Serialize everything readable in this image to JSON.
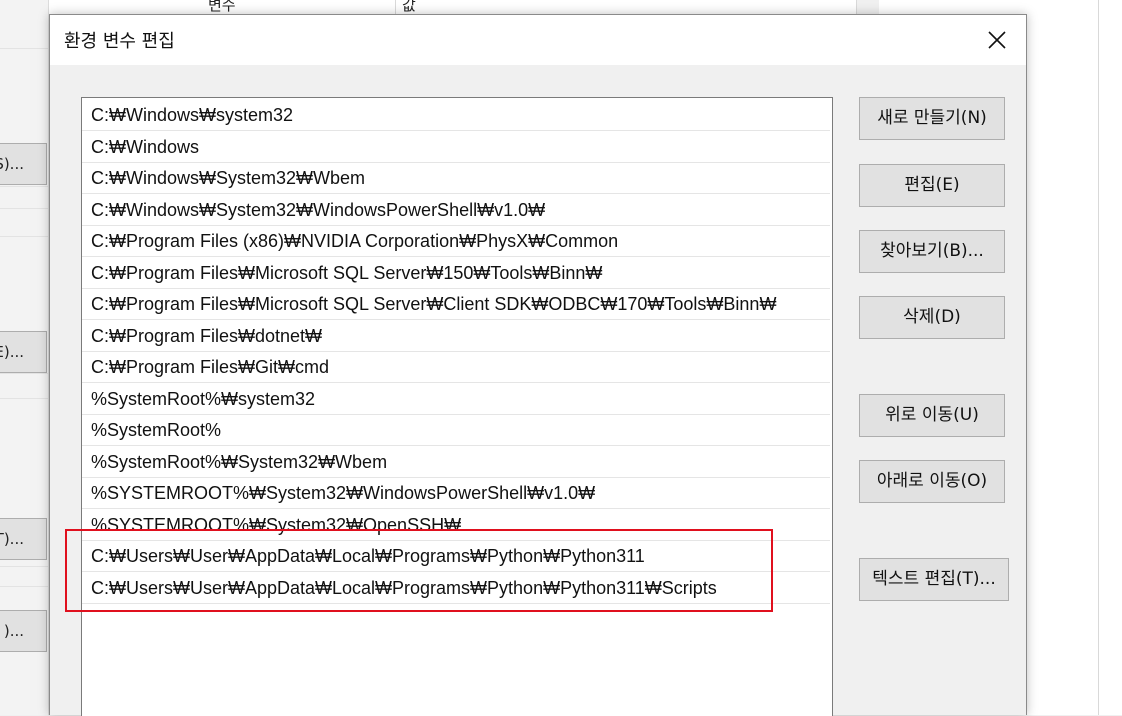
{
  "background_window": {
    "header_left": "변수",
    "header_right": "값",
    "partial_buttons": [
      "S)...",
      "E)...",
      "T)...",
      ")..."
    ]
  },
  "dialog": {
    "title": "환경 변수 편집",
    "close_icon": "close-icon",
    "entries": [
      "C:₩Windows₩system32",
      "C:₩Windows",
      "C:₩Windows₩System32₩Wbem",
      "C:₩Windows₩System32₩WindowsPowerShell₩v1.0₩",
      "C:₩Program Files (x86)₩NVIDIA Corporation₩PhysX₩Common",
      "C:₩Program Files₩Microsoft SQL Server₩150₩Tools₩Binn₩",
      "C:₩Program Files₩Microsoft SQL Server₩Client SDK₩ODBC₩170₩Tools₩Binn₩",
      "C:₩Program Files₩dotnet₩",
      "C:₩Program Files₩Git₩cmd",
      "%SystemRoot%₩system32",
      "%SystemRoot%",
      "%SystemRoot%₩System32₩Wbem",
      "%SYSTEMROOT%₩System32₩WindowsPowerShell₩v1.0₩",
      "%SYSTEMROOT%₩System32₩OpenSSH₩",
      "C:₩Users₩User₩AppData₩Local₩Programs₩Python₩Python311",
      "C:₩Users₩User₩AppData₩Local₩Programs₩Python₩Python311₩Scripts"
    ],
    "buttons": {
      "new": "새로 만들기(N)",
      "edit": "편집(E)",
      "browse": "찾아보기(B)...",
      "delete": "삭제(D)",
      "move_up": "위로 이동(U)",
      "move_down": "아래로 이동(O)",
      "edit_text": "텍스트 편집(T)..."
    },
    "highlight_color": "#e0101e"
  }
}
